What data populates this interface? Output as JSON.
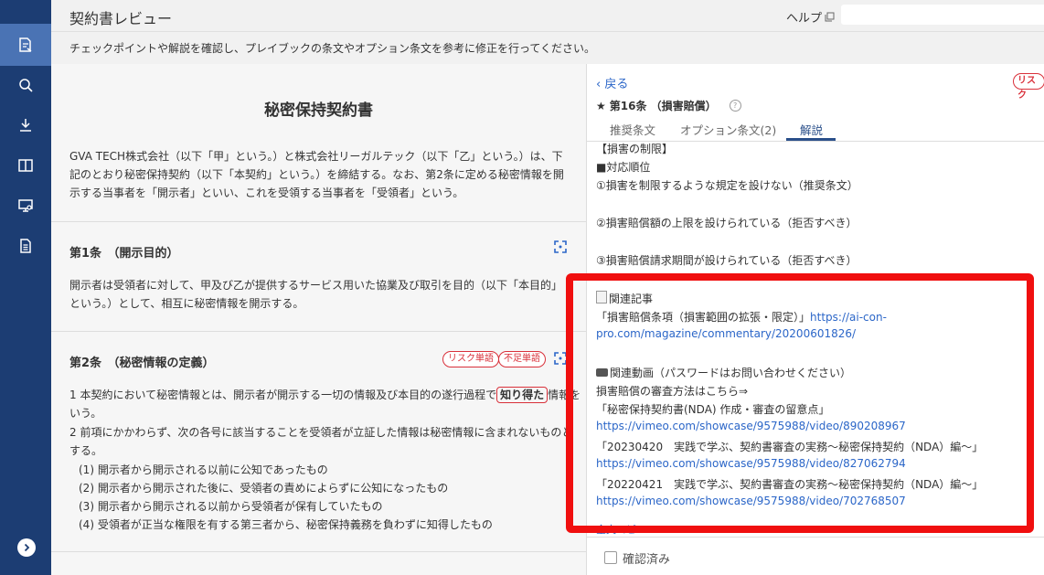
{
  "app": {
    "title": "契約書レビュー",
    "help_label": "ヘルプ",
    "instruction": "チェックポイントや解説を確認し、プレイブックの条文やオプション条文を参考に修正を行ってください。"
  },
  "sidebar": {
    "items": [
      {
        "icon": "document-review-icon",
        "active": true
      },
      {
        "icon": "search-icon"
      },
      {
        "icon": "download-icon"
      },
      {
        "icon": "compare-icon"
      },
      {
        "icon": "monitor-settings-icon"
      },
      {
        "icon": "document-list-icon"
      }
    ],
    "expand_icon": "chevron-right-icon"
  },
  "document": {
    "title": "秘密保持契約書",
    "preamble": "GVA TECH株式会社（以下「甲」という。）と株式会社リーガルテック（以下「乙」という。）は、下記のとおり秘密保持契約（以下「本契約」という。）を締結する。なお、第2条に定める秘密情報を開示する当事者を「開示者」といい、これを受領する当事者を「受領者」という。",
    "article1": {
      "heading": "第1条　（開示目的）",
      "body": "開示者は受領者に対して、甲及び乙が提供するサービス用いた協業及び取引を目的（以下「本目的」という。）として、相互に秘密情報を開示する。"
    },
    "article2": {
      "heading": "第2条　（秘密情報の定義）",
      "tags": [
        "リスク単語",
        "不足単語"
      ],
      "para1_before": "1 本契約において秘密情報とは、開示者が開示する一切の情報及び本目的の遂行過程で",
      "para1_highlight": "知り得た",
      "para1_after": "情報をいう。",
      "para2": "2 前項にかかわらず、次の各号に該当することを受領者が立証した情報は秘密情報に含まれないものとする。",
      "items": [
        "(1) 開示者から開示される以前に公知であったもの",
        "(2) 開示者から開示された後に、受領者の責めによらずに公知になったもの",
        "(3) 開示者から開示される以前から受領者が保有していたもの",
        "(4) 受領者が正当な権限を有する第三者から、秘密保持義務を負わずに知得したもの"
      ]
    }
  },
  "panel": {
    "back_label": "戻る",
    "risk_badge": "リスク",
    "article_title": "第16条 （損害賠償）",
    "tabs": [
      {
        "label": "推奨条文"
      },
      {
        "label": "オプション条文(2)"
      },
      {
        "label": "解説",
        "active": true
      }
    ],
    "lines": [
      "【損害の制限】",
      "■対応順位",
      "①損害を制限するような規定を設けない（推奨条文）",
      "②損害賠償額の上限を設けられている（拒否すべき）",
      "③損害賠償請求期間が設けられている（拒否すべき）",
      "関連記事",
      "「損害賠償条項（損害範囲の拡張・限定）」",
      "https://ai-con-",
      "pro.com/magazine/commentary/20200601826/",
      "関連動画（パスワードはお問い合わせください）",
      "損害賠償の審査方法はこちら⇒",
      "「秘密保持契約書(NDA) 作成・審査の留意点」",
      "https://vimeo.com/showcase/9575988/video/890208967",
      "「20230420　実践で学ぶ、契約書審査の実務〜秘密保持契約（NDA）編〜」",
      "https://vimeo.com/showcase/9575988/video/827062794",
      "「20220421　実践で学ぶ、契約書審査の実務〜秘密保持契約（NDA）編〜」",
      "https://vimeo.com/showcase/9575988/video/702768507"
    ],
    "copy_label": "全文コピー",
    "confirm_label": "確認済み"
  },
  "colors": {
    "sidebar": "#1c3d73",
    "sidebar_active": "#4a73b4",
    "link": "#2b66c8",
    "risk": "#d9303a",
    "annotation_box": "#f00f0f"
  }
}
